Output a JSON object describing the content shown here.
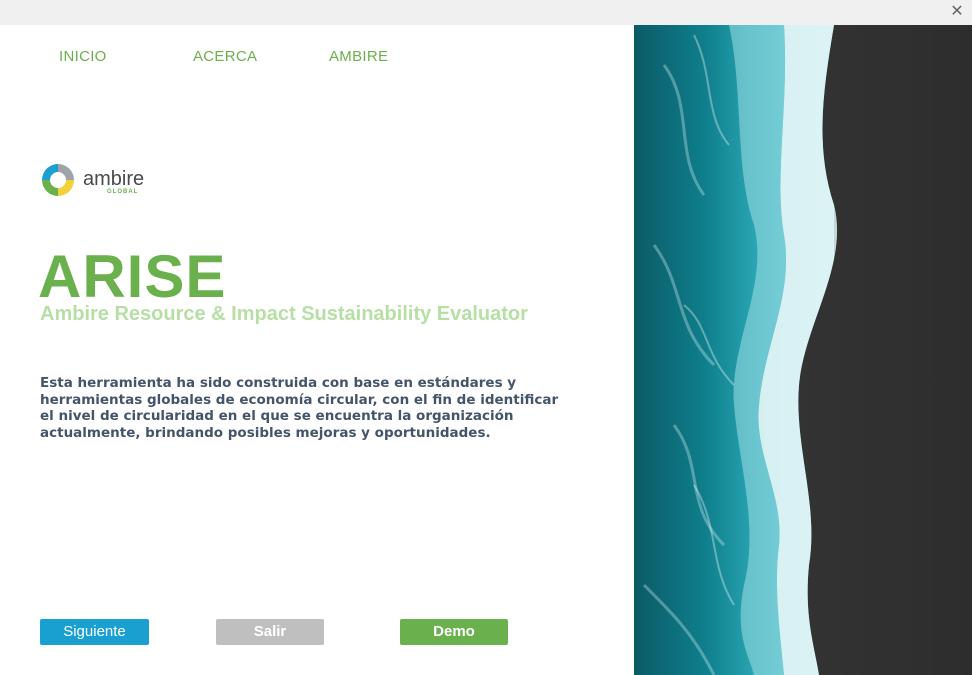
{
  "window": {
    "close_glyph": "✕"
  },
  "nav": {
    "items": [
      "INICIO",
      "ACERCA",
      "AMBIRE"
    ]
  },
  "logo": {
    "name": "ambire",
    "tagline": "GLOBAL"
  },
  "hero": {
    "title": "ARISE",
    "subtitle": "Ambire Resource & Impact Sustainability Evaluator",
    "description": "Esta herramienta  ha sido construida  con base en estándares y herramientas  globales de economía circular,  con el fin de identificar el nivel de circularidad  en el que se encuentra la organización actualmente, brindando  posibles mejoras y oportunidades."
  },
  "buttons": {
    "next": "Siguiente",
    "exit": "Salir",
    "demo": "Demo"
  },
  "colors": {
    "green": "#6ab04c",
    "light_green": "#b7dfa5",
    "blue": "#1aa0d0",
    "grey": "#bfbfbf",
    "text": "#44546a"
  },
  "image": {
    "subject": "aerial-ocean-shore-photo"
  }
}
